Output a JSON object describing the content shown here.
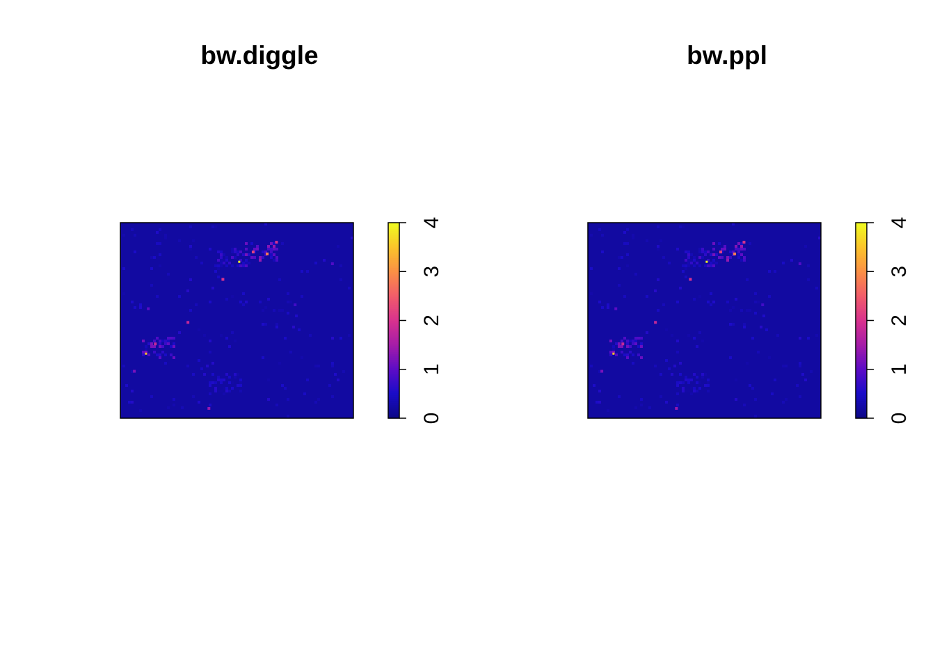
{
  "chart_data": [
    {
      "type": "heatmap",
      "title": "bw.diggle",
      "colorbar": {
        "ticks": [
          0,
          1,
          2,
          3,
          4
        ],
        "tick_labels": [
          "0",
          "1",
          "2",
          "3",
          "4"
        ],
        "range": [
          0,
          4
        ],
        "colors": [
          "#0D0887",
          "#1A0CC8",
          "#5D0CC6",
          "#A51CA8",
          "#D8328E",
          "#F15B6B",
          "#FB8E46",
          "#FBC22B",
          "#F0F921"
        ]
      },
      "axes": "none",
      "background_value": 0.2,
      "hotspots": [
        {
          "x": 0.51,
          "y": 0.8,
          "value": 4.0
        },
        {
          "x": 0.63,
          "y": 0.84,
          "value": 2.8
        },
        {
          "x": 0.57,
          "y": 0.85,
          "value": 2.2
        },
        {
          "x": 0.67,
          "y": 0.9,
          "value": 2.0
        },
        {
          "x": 0.44,
          "y": 0.71,
          "value": 2.0
        },
        {
          "x": 0.29,
          "y": 0.49,
          "value": 1.8
        },
        {
          "x": 0.15,
          "y": 0.38,
          "value": 1.8
        },
        {
          "x": 0.11,
          "y": 0.33,
          "value": 3.5
        },
        {
          "x": 0.06,
          "y": 0.24,
          "value": 1.2
        },
        {
          "x": 0.38,
          "y": 0.05,
          "value": 1.4
        },
        {
          "x": 0.91,
          "y": 0.79,
          "value": 0.9
        },
        {
          "x": 0.12,
          "y": 0.56,
          "value": 1.0
        },
        {
          "x": 0.75,
          "y": 0.58,
          "value": 0.8
        }
      ],
      "clusters": [
        {
          "x": 0.6,
          "y": 0.86,
          "value": 1.4
        },
        {
          "x": 0.48,
          "y": 0.82,
          "value": 0.9
        },
        {
          "x": 0.16,
          "y": 0.37,
          "value": 1.2
        },
        {
          "x": 0.45,
          "y": 0.18,
          "value": 0.6
        }
      ]
    },
    {
      "type": "heatmap",
      "title": "bw.ppl",
      "colorbar": {
        "ticks": [
          0,
          1,
          2,
          3,
          4
        ],
        "tick_labels": [
          "0",
          "1",
          "2",
          "3",
          "4"
        ],
        "range": [
          0,
          4
        ],
        "colors": [
          "#0D0887",
          "#1A0CC8",
          "#5D0CC6",
          "#A51CA8",
          "#D8328E",
          "#F15B6B",
          "#FB8E46",
          "#FBC22B",
          "#F0F921"
        ]
      },
      "axes": "none",
      "background_value": 0.2,
      "hotspots": [
        {
          "x": 0.51,
          "y": 0.8,
          "value": 4.0
        },
        {
          "x": 0.63,
          "y": 0.84,
          "value": 2.8
        },
        {
          "x": 0.57,
          "y": 0.85,
          "value": 2.2
        },
        {
          "x": 0.67,
          "y": 0.9,
          "value": 2.0
        },
        {
          "x": 0.44,
          "y": 0.71,
          "value": 2.0
        },
        {
          "x": 0.29,
          "y": 0.49,
          "value": 1.8
        },
        {
          "x": 0.15,
          "y": 0.38,
          "value": 1.8
        },
        {
          "x": 0.11,
          "y": 0.33,
          "value": 3.5
        },
        {
          "x": 0.06,
          "y": 0.24,
          "value": 1.2
        },
        {
          "x": 0.38,
          "y": 0.05,
          "value": 1.4
        },
        {
          "x": 0.91,
          "y": 0.79,
          "value": 0.9
        },
        {
          "x": 0.12,
          "y": 0.56,
          "value": 1.0
        },
        {
          "x": 0.75,
          "y": 0.58,
          "value": 0.8
        }
      ],
      "clusters": [
        {
          "x": 0.6,
          "y": 0.86,
          "value": 1.4
        },
        {
          "x": 0.48,
          "y": 0.82,
          "value": 0.9
        },
        {
          "x": 0.16,
          "y": 0.37,
          "value": 1.2
        },
        {
          "x": 0.45,
          "y": 0.18,
          "value": 0.6
        }
      ]
    }
  ]
}
